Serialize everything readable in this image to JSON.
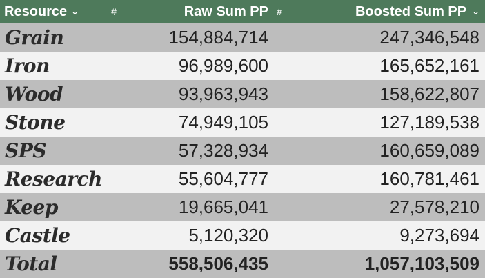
{
  "header": {
    "resource_label": "Resource",
    "hash1": "#",
    "raw_label": "Raw Sum PP",
    "hash2": "#",
    "boosted_label": "Boosted Sum PP",
    "filter_icon": "chevron-down-icon"
  },
  "rows": [
    {
      "name": "Grain",
      "raw": "154,884,714",
      "boosted": "247,346,548"
    },
    {
      "name": "Iron",
      "raw": "96,989,600",
      "boosted": "165,652,161"
    },
    {
      "name": "Wood",
      "raw": "93,963,943",
      "boosted": "158,622,807"
    },
    {
      "name": "Stone",
      "raw": "74,949,105",
      "boosted": "127,189,538"
    },
    {
      "name": "SPS",
      "raw": "57,328,934",
      "boosted": "160,659,089"
    },
    {
      "name": "Research",
      "raw": "55,604,777",
      "boosted": "160,781,461"
    },
    {
      "name": "Keep",
      "raw": "19,665,041",
      "boosted": "27,578,210"
    },
    {
      "name": "Castle",
      "raw": "5,120,320",
      "boosted": "9,273,694"
    }
  ],
  "total": {
    "name": "Total",
    "raw": "558,506,435",
    "boosted": "1,057,103,509"
  },
  "colors": {
    "header_bg": "#4e7a5b",
    "row_dark": "#bdbdbd",
    "row_light": "#f2f2f2"
  }
}
